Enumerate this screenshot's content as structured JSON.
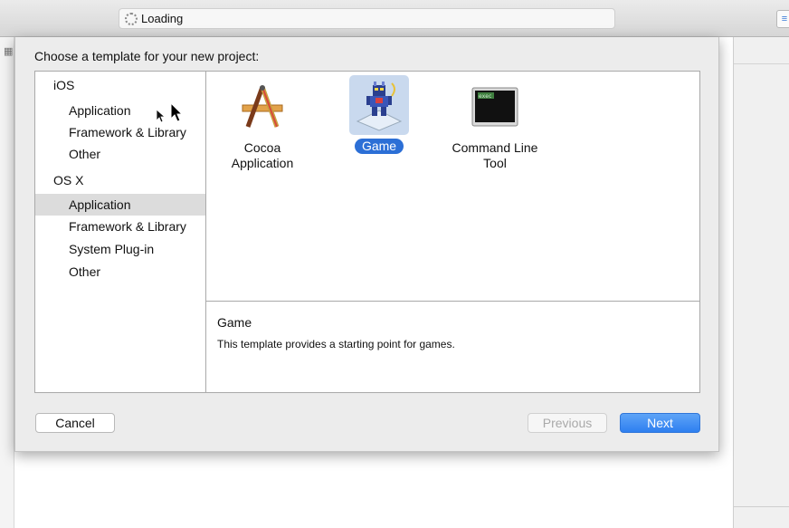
{
  "toolbar": {
    "activity_text": "Loading"
  },
  "dialog": {
    "title": "Choose a template for your new project:",
    "sidebar": {
      "ios_header": "iOS",
      "ios_items": [
        "Application",
        "Framework & Library",
        "Other"
      ],
      "osx_header": "OS X",
      "osx_items": [
        "Application",
        "Framework & Library",
        "System Plug-in",
        "Other"
      ],
      "selected": "OS X / Application"
    },
    "templates": [
      {
        "label": "Cocoa Application",
        "icon": "cocoa-app-icon"
      },
      {
        "label": "Game",
        "icon": "game-icon",
        "selected": true
      },
      {
        "label": "Command Line Tool",
        "icon": "terminal-icon",
        "icon_text": "exec"
      }
    ],
    "description": {
      "title": "Game",
      "text": "This template provides a starting point for games."
    },
    "buttons": {
      "cancel": "Cancel",
      "previous": "Previous",
      "next": "Next"
    }
  },
  "colors": {
    "accent": "#2c6fd6",
    "selection_bg": "#c9d9ee",
    "sidebar_selected": "#dcdcdc"
  }
}
